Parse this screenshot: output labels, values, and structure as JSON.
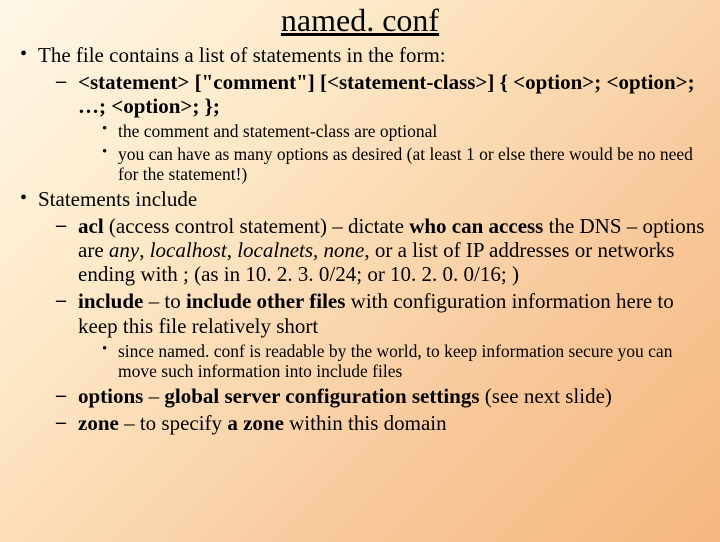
{
  "title": "named. conf",
  "p1": "The file contains a list of statements in the form:",
  "syntax": "<statement> [\"comment\"] [<statement-class>] { <option>; <option>; …; <option>; };",
  "sub1a": "the comment and statement-class are optional",
  "sub1b": "you can have as many options as desired (at least 1 or else there would be no need for the statement!)",
  "p2": "Statements include",
  "acl_b1": "acl",
  "acl_t1": " (access control statement) – dictate ",
  "acl_b2": "who can access",
  "acl_t2": " the DNS – options are ",
  "acl_i1": "any",
  "acl_c": ", ",
  "acl_i2": "localhost",
  "acl_i3": "localnets",
  "acl_i4": "none",
  "acl_t3": ", or a list of IP addresses or networks ending with  ; (as in 10. 2. 3. 0/24;  or 10. 2. 0. 0/16; )",
  "inc_b1": "include",
  "inc_t1": " – to ",
  "inc_b2": "include other files",
  "inc_t2": " with configuration information here to keep this file relatively short",
  "sub2a": "since named. conf is readable by the world, to keep information secure you can move such information into include files",
  "opt_b1": "options",
  "opt_t1": " – ",
  "opt_b2": "global server configuration settings",
  "opt_t2": " (see next slide)",
  "zone_b1": "zone",
  "zone_t1": " – to specify ",
  "zone_b2": "a zone",
  "zone_t2": " within this domain"
}
